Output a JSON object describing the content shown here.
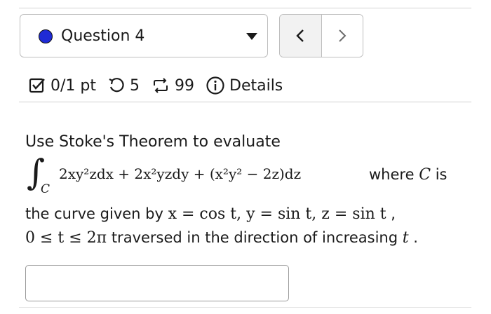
{
  "question_nav": {
    "label": "Question 4",
    "indicator_color": "#1f2bd6",
    "prev_icon": "chevron-left-icon",
    "next_icon": "chevron-right-icon"
  },
  "meta": {
    "score": "0/1 pt",
    "retries": "5",
    "submissions": "99",
    "details_label": "Details"
  },
  "problem": {
    "intro": "Use Stoke's Theorem to evaluate",
    "integral_symbol": "∫",
    "integral_subscript": "C",
    "integrand": "2xy²zdx + 2x²yzdy + (x²y² − 2z)dz",
    "where_text": "where",
    "curve_var": "C",
    "is_text": "is",
    "curve_text": "the curve given by",
    "curve_eq": "x = cos t, y = sin t, z = sin t",
    "comma": ",",
    "range_eq": "0 ≤ t ≤ 2π",
    "traversed_text": "traversed in the direction of increasing",
    "param_var": "t",
    "period": "."
  },
  "answer": {
    "placeholder": "",
    "value": ""
  }
}
